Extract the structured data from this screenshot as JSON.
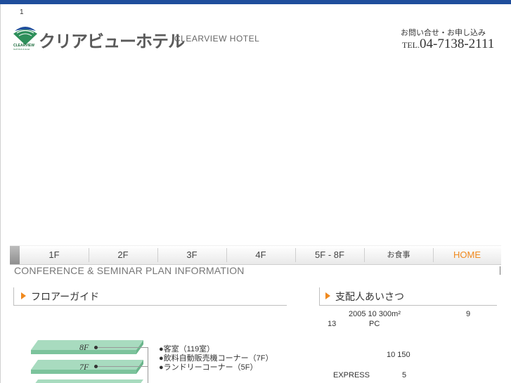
{
  "page": {
    "number": "1"
  },
  "brand": {
    "name_jp": "クリアビューホテル",
    "name_en": "CLEARVIEW HOTEL",
    "mark_text": "CLEARVIEW",
    "mark_subtext": "Golf Club & Hotel",
    "colors": {
      "top_bar": "#1f4e9c",
      "logo_green": "#2e8f5a",
      "logo_blue": "#1f4e9c",
      "accent": "#f0891e"
    }
  },
  "contact": {
    "label": "お問い合せ・お申し込み",
    "tel_prefix": "TEL.",
    "tel_number": "04-7138-2111"
  },
  "nav": {
    "items": [
      {
        "label": "1F"
      },
      {
        "label": "2F"
      },
      {
        "label": "3F"
      },
      {
        "label": "4F"
      },
      {
        "label": "5F - 8F"
      },
      {
        "label": "お食事"
      },
      {
        "label": "HOME"
      }
    ]
  },
  "banner": {
    "text": "CONFERENCE & SEMINAR PLAN INFORMATION"
  },
  "floor_guide": {
    "title": "フロアーガイド",
    "arrow_icon": "triangle-right-icon",
    "floors": [
      {
        "label": "8F"
      },
      {
        "label": "7F"
      }
    ],
    "notes": [
      "●客室（119室）",
      "●飲料自動販売機コーナー（7F）",
      "●ランドリーコーナー（5F）"
    ]
  },
  "greeting": {
    "title": "支配人あいさつ",
    "arrow_icon": "triangle-right-icon",
    "fragments": {
      "f1": "2005 10  300m²",
      "f2": "9",
      "f3": "13",
      "f4": "PC",
      "f5": "10   150",
      "f6": "EXPRESS",
      "f7": "5"
    }
  }
}
